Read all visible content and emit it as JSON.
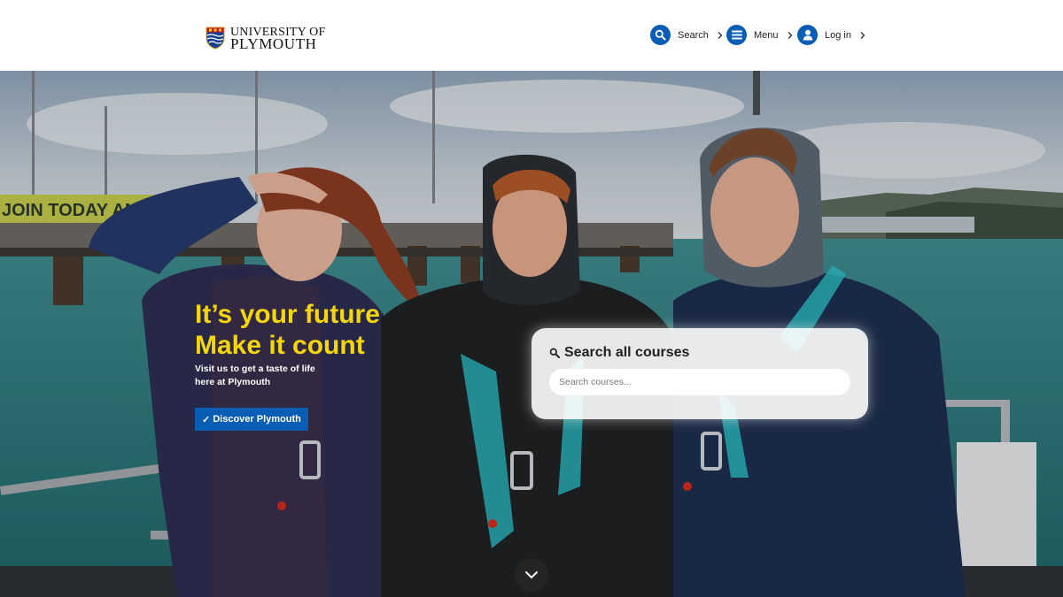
{
  "logo": {
    "line1": "UNIVERSITY OF",
    "line2": "PLYMOUTH"
  },
  "nav": {
    "search_label": "Search",
    "menu_label": "Menu",
    "login_label": "Log in"
  },
  "hero": {
    "banner_text": "JOIN TODAY AND",
    "headline_line1": "It’s your future",
    "headline_line2": "Make it count",
    "subtext_line1": "Visit us to get a taste of life",
    "subtext_line2": "here at Plymouth",
    "discover_button": "Discover Plymouth",
    "discover_check": "✓"
  },
  "search": {
    "title": "Search all courses",
    "placeholder": "Search courses..."
  },
  "colors": {
    "brand_blue": "#0a5db5",
    "headline_yellow": "#f5d60d"
  },
  "icons": {
    "search": "magnifier-icon",
    "menu": "hamburger-icon",
    "login": "user-icon",
    "chevron": "chevron-right-icon",
    "scroll": "chevron-down-icon"
  }
}
